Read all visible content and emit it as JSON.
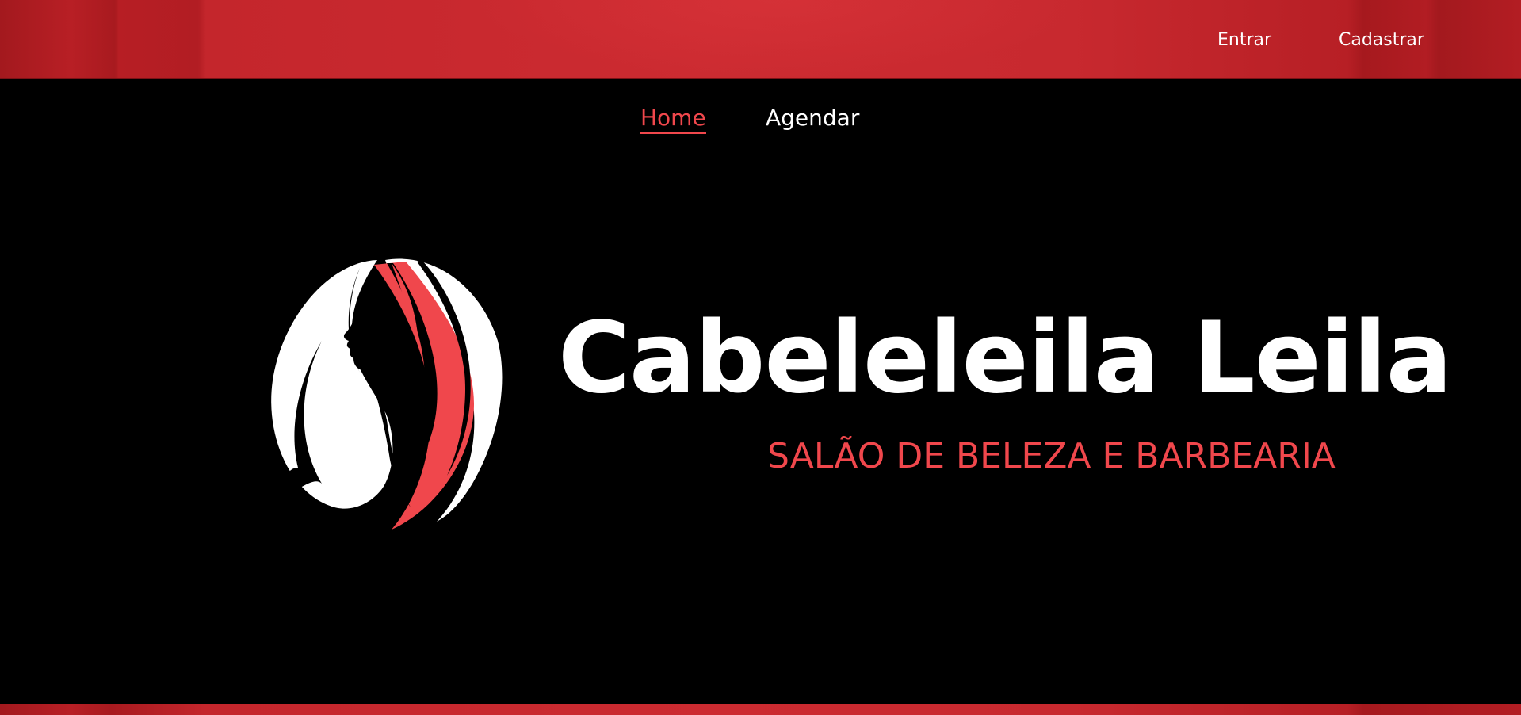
{
  "colors": {
    "accent": "#f0474c",
    "header_red": "#c4262c",
    "background": "#000000"
  },
  "header": {
    "login_label": "Entrar",
    "register_label": "Cadastrar"
  },
  "nav": {
    "items": [
      {
        "label": "Home",
        "active": true
      },
      {
        "label": "Agendar",
        "active": false
      }
    ]
  },
  "hero": {
    "logo_icon": "woman-hair-silhouette-icon",
    "title": "Cabeleleila Leila",
    "subtitle": "SALÃO DE BELEZA E BARBEARIA"
  }
}
